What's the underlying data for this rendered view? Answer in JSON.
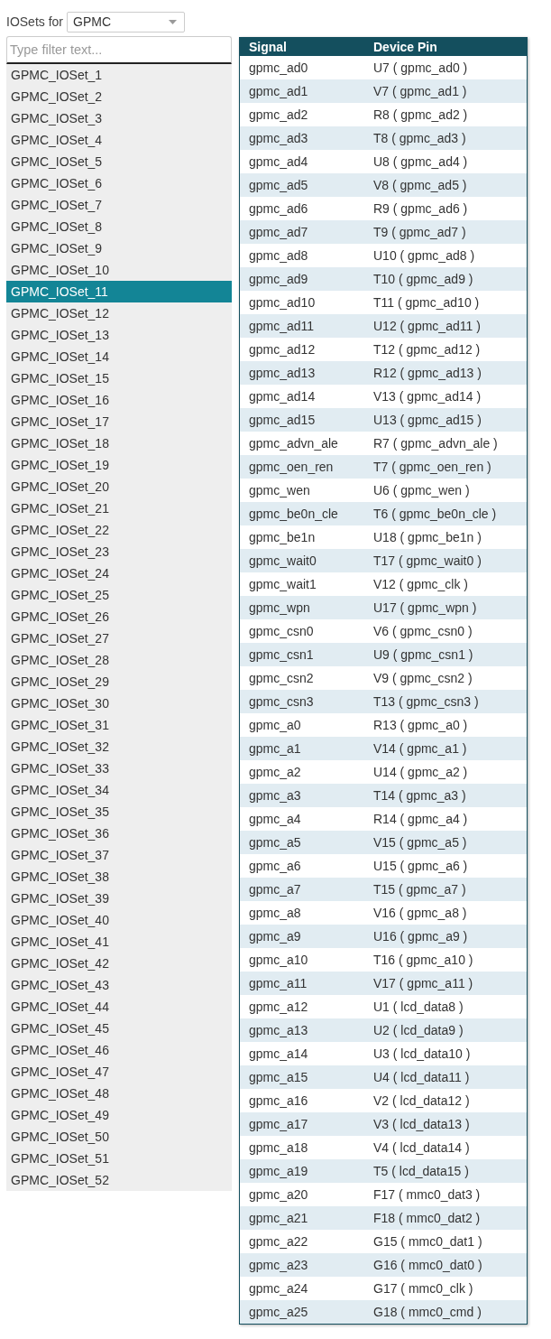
{
  "iosets_label": "IOSets for",
  "peripheral_select": {
    "value": "GPMC"
  },
  "filter": {
    "placeholder": "Type filter text..."
  },
  "iosets": [
    {
      "label": "GPMC_IOSet_1",
      "selected": false
    },
    {
      "label": "GPMC_IOSet_2",
      "selected": false
    },
    {
      "label": "GPMC_IOSet_3",
      "selected": false
    },
    {
      "label": "GPMC_IOSet_4",
      "selected": false
    },
    {
      "label": "GPMC_IOSet_5",
      "selected": false
    },
    {
      "label": "GPMC_IOSet_6",
      "selected": false
    },
    {
      "label": "GPMC_IOSet_7",
      "selected": false
    },
    {
      "label": "GPMC_IOSet_8",
      "selected": false
    },
    {
      "label": "GPMC_IOSet_9",
      "selected": false
    },
    {
      "label": "GPMC_IOSet_10",
      "selected": false
    },
    {
      "label": "GPMC_IOSet_11",
      "selected": true
    },
    {
      "label": "GPMC_IOSet_12",
      "selected": false
    },
    {
      "label": "GPMC_IOSet_13",
      "selected": false
    },
    {
      "label": "GPMC_IOSet_14",
      "selected": false
    },
    {
      "label": "GPMC_IOSet_15",
      "selected": false
    },
    {
      "label": "GPMC_IOSet_16",
      "selected": false
    },
    {
      "label": "GPMC_IOSet_17",
      "selected": false
    },
    {
      "label": "GPMC_IOSet_18",
      "selected": false
    },
    {
      "label": "GPMC_IOSet_19",
      "selected": false
    },
    {
      "label": "GPMC_IOSet_20",
      "selected": false
    },
    {
      "label": "GPMC_IOSet_21",
      "selected": false
    },
    {
      "label": "GPMC_IOSet_22",
      "selected": false
    },
    {
      "label": "GPMC_IOSet_23",
      "selected": false
    },
    {
      "label": "GPMC_IOSet_24",
      "selected": false
    },
    {
      "label": "GPMC_IOSet_25",
      "selected": false
    },
    {
      "label": "GPMC_IOSet_26",
      "selected": false
    },
    {
      "label": "GPMC_IOSet_27",
      "selected": false
    },
    {
      "label": "GPMC_IOSet_28",
      "selected": false
    },
    {
      "label": "GPMC_IOSet_29",
      "selected": false
    },
    {
      "label": "GPMC_IOSet_30",
      "selected": false
    },
    {
      "label": "GPMC_IOSet_31",
      "selected": false
    },
    {
      "label": "GPMC_IOSet_32",
      "selected": false
    },
    {
      "label": "GPMC_IOSet_33",
      "selected": false
    },
    {
      "label": "GPMC_IOSet_34",
      "selected": false
    },
    {
      "label": "GPMC_IOSet_35",
      "selected": false
    },
    {
      "label": "GPMC_IOSet_36",
      "selected": false
    },
    {
      "label": "GPMC_IOSet_37",
      "selected": false
    },
    {
      "label": "GPMC_IOSet_38",
      "selected": false
    },
    {
      "label": "GPMC_IOSet_39",
      "selected": false
    },
    {
      "label": "GPMC_IOSet_40",
      "selected": false
    },
    {
      "label": "GPMC_IOSet_41",
      "selected": false
    },
    {
      "label": "GPMC_IOSet_42",
      "selected": false
    },
    {
      "label": "GPMC_IOSet_43",
      "selected": false
    },
    {
      "label": "GPMC_IOSet_44",
      "selected": false
    },
    {
      "label": "GPMC_IOSet_45",
      "selected": false
    },
    {
      "label": "GPMC_IOSet_46",
      "selected": false
    },
    {
      "label": "GPMC_IOSet_47",
      "selected": false
    },
    {
      "label": "GPMC_IOSet_48",
      "selected": false
    },
    {
      "label": "GPMC_IOSet_49",
      "selected": false
    },
    {
      "label": "GPMC_IOSet_50",
      "selected": false
    },
    {
      "label": "GPMC_IOSet_51",
      "selected": false
    },
    {
      "label": "GPMC_IOSet_52",
      "selected": false
    }
  ],
  "table": {
    "columns": [
      "Signal",
      "Device Pin"
    ],
    "rows": [
      [
        "gpmc_ad0",
        "U7 ( gpmc_ad0 )"
      ],
      [
        "gpmc_ad1",
        "V7 ( gpmc_ad1 )"
      ],
      [
        "gpmc_ad2",
        "R8 ( gpmc_ad2 )"
      ],
      [
        "gpmc_ad3",
        "T8 ( gpmc_ad3 )"
      ],
      [
        "gpmc_ad4",
        "U8 ( gpmc_ad4 )"
      ],
      [
        "gpmc_ad5",
        "V8 ( gpmc_ad5 )"
      ],
      [
        "gpmc_ad6",
        "R9 ( gpmc_ad6 )"
      ],
      [
        "gpmc_ad7",
        "T9 ( gpmc_ad7 )"
      ],
      [
        "gpmc_ad8",
        "U10 ( gpmc_ad8 )"
      ],
      [
        "gpmc_ad9",
        "T10 ( gpmc_ad9 )"
      ],
      [
        "gpmc_ad10",
        "T11 ( gpmc_ad10 )"
      ],
      [
        "gpmc_ad11",
        "U12 ( gpmc_ad11 )"
      ],
      [
        "gpmc_ad12",
        "T12 ( gpmc_ad12 )"
      ],
      [
        "gpmc_ad13",
        "R12 ( gpmc_ad13 )"
      ],
      [
        "gpmc_ad14",
        "V13 ( gpmc_ad14 )"
      ],
      [
        "gpmc_ad15",
        "U13 ( gpmc_ad15 )"
      ],
      [
        "gpmc_advn_ale",
        "R7 ( gpmc_advn_ale )"
      ],
      [
        "gpmc_oen_ren",
        "T7 ( gpmc_oen_ren )"
      ],
      [
        "gpmc_wen",
        "U6 ( gpmc_wen )"
      ],
      [
        "gpmc_be0n_cle",
        "T6 ( gpmc_be0n_cle )"
      ],
      [
        "gpmc_be1n",
        "U18 ( gpmc_be1n )"
      ],
      [
        "gpmc_wait0",
        "T17 ( gpmc_wait0 )"
      ],
      [
        "gpmc_wait1",
        "V12 ( gpmc_clk )"
      ],
      [
        "gpmc_wpn",
        "U17 ( gpmc_wpn )"
      ],
      [
        "gpmc_csn0",
        "V6 ( gpmc_csn0 )"
      ],
      [
        "gpmc_csn1",
        "U9 ( gpmc_csn1 )"
      ],
      [
        "gpmc_csn2",
        "V9 ( gpmc_csn2 )"
      ],
      [
        "gpmc_csn3",
        "T13 ( gpmc_csn3 )"
      ],
      [
        "gpmc_a0",
        "R13 ( gpmc_a0 )"
      ],
      [
        "gpmc_a1",
        "V14 ( gpmc_a1 )"
      ],
      [
        "gpmc_a2",
        "U14 ( gpmc_a2 )"
      ],
      [
        "gpmc_a3",
        "T14 ( gpmc_a3 )"
      ],
      [
        "gpmc_a4",
        "R14 ( gpmc_a4 )"
      ],
      [
        "gpmc_a5",
        "V15 ( gpmc_a5 )"
      ],
      [
        "gpmc_a6",
        "U15 ( gpmc_a6 )"
      ],
      [
        "gpmc_a7",
        "T15 ( gpmc_a7 )"
      ],
      [
        "gpmc_a8",
        "V16 ( gpmc_a8 )"
      ],
      [
        "gpmc_a9",
        "U16 ( gpmc_a9 )"
      ],
      [
        "gpmc_a10",
        "T16 ( gpmc_a10 )"
      ],
      [
        "gpmc_a11",
        "V17 ( gpmc_a11 )"
      ],
      [
        "gpmc_a12",
        "U1 ( lcd_data8 )"
      ],
      [
        "gpmc_a13",
        "U2 ( lcd_data9 )"
      ],
      [
        "gpmc_a14",
        "U3 ( lcd_data10 )"
      ],
      [
        "gpmc_a15",
        "U4 ( lcd_data11 )"
      ],
      [
        "gpmc_a16",
        "V2 ( lcd_data12 )"
      ],
      [
        "gpmc_a17",
        "V3 ( lcd_data13 )"
      ],
      [
        "gpmc_a18",
        "V4 ( lcd_data14 )"
      ],
      [
        "gpmc_a19",
        "T5 ( lcd_data15 )"
      ],
      [
        "gpmc_a20",
        "F17 ( mmc0_dat3 )"
      ],
      [
        "gpmc_a21",
        "F18 ( mmc0_dat2 )"
      ],
      [
        "gpmc_a22",
        "G15 ( mmc0_dat1 )"
      ],
      [
        "gpmc_a23",
        "G16 ( mmc0_dat0 )"
      ],
      [
        "gpmc_a24",
        "G17 ( mmc0_clk )"
      ],
      [
        "gpmc_a25",
        "G18 ( mmc0_cmd )"
      ]
    ]
  }
}
